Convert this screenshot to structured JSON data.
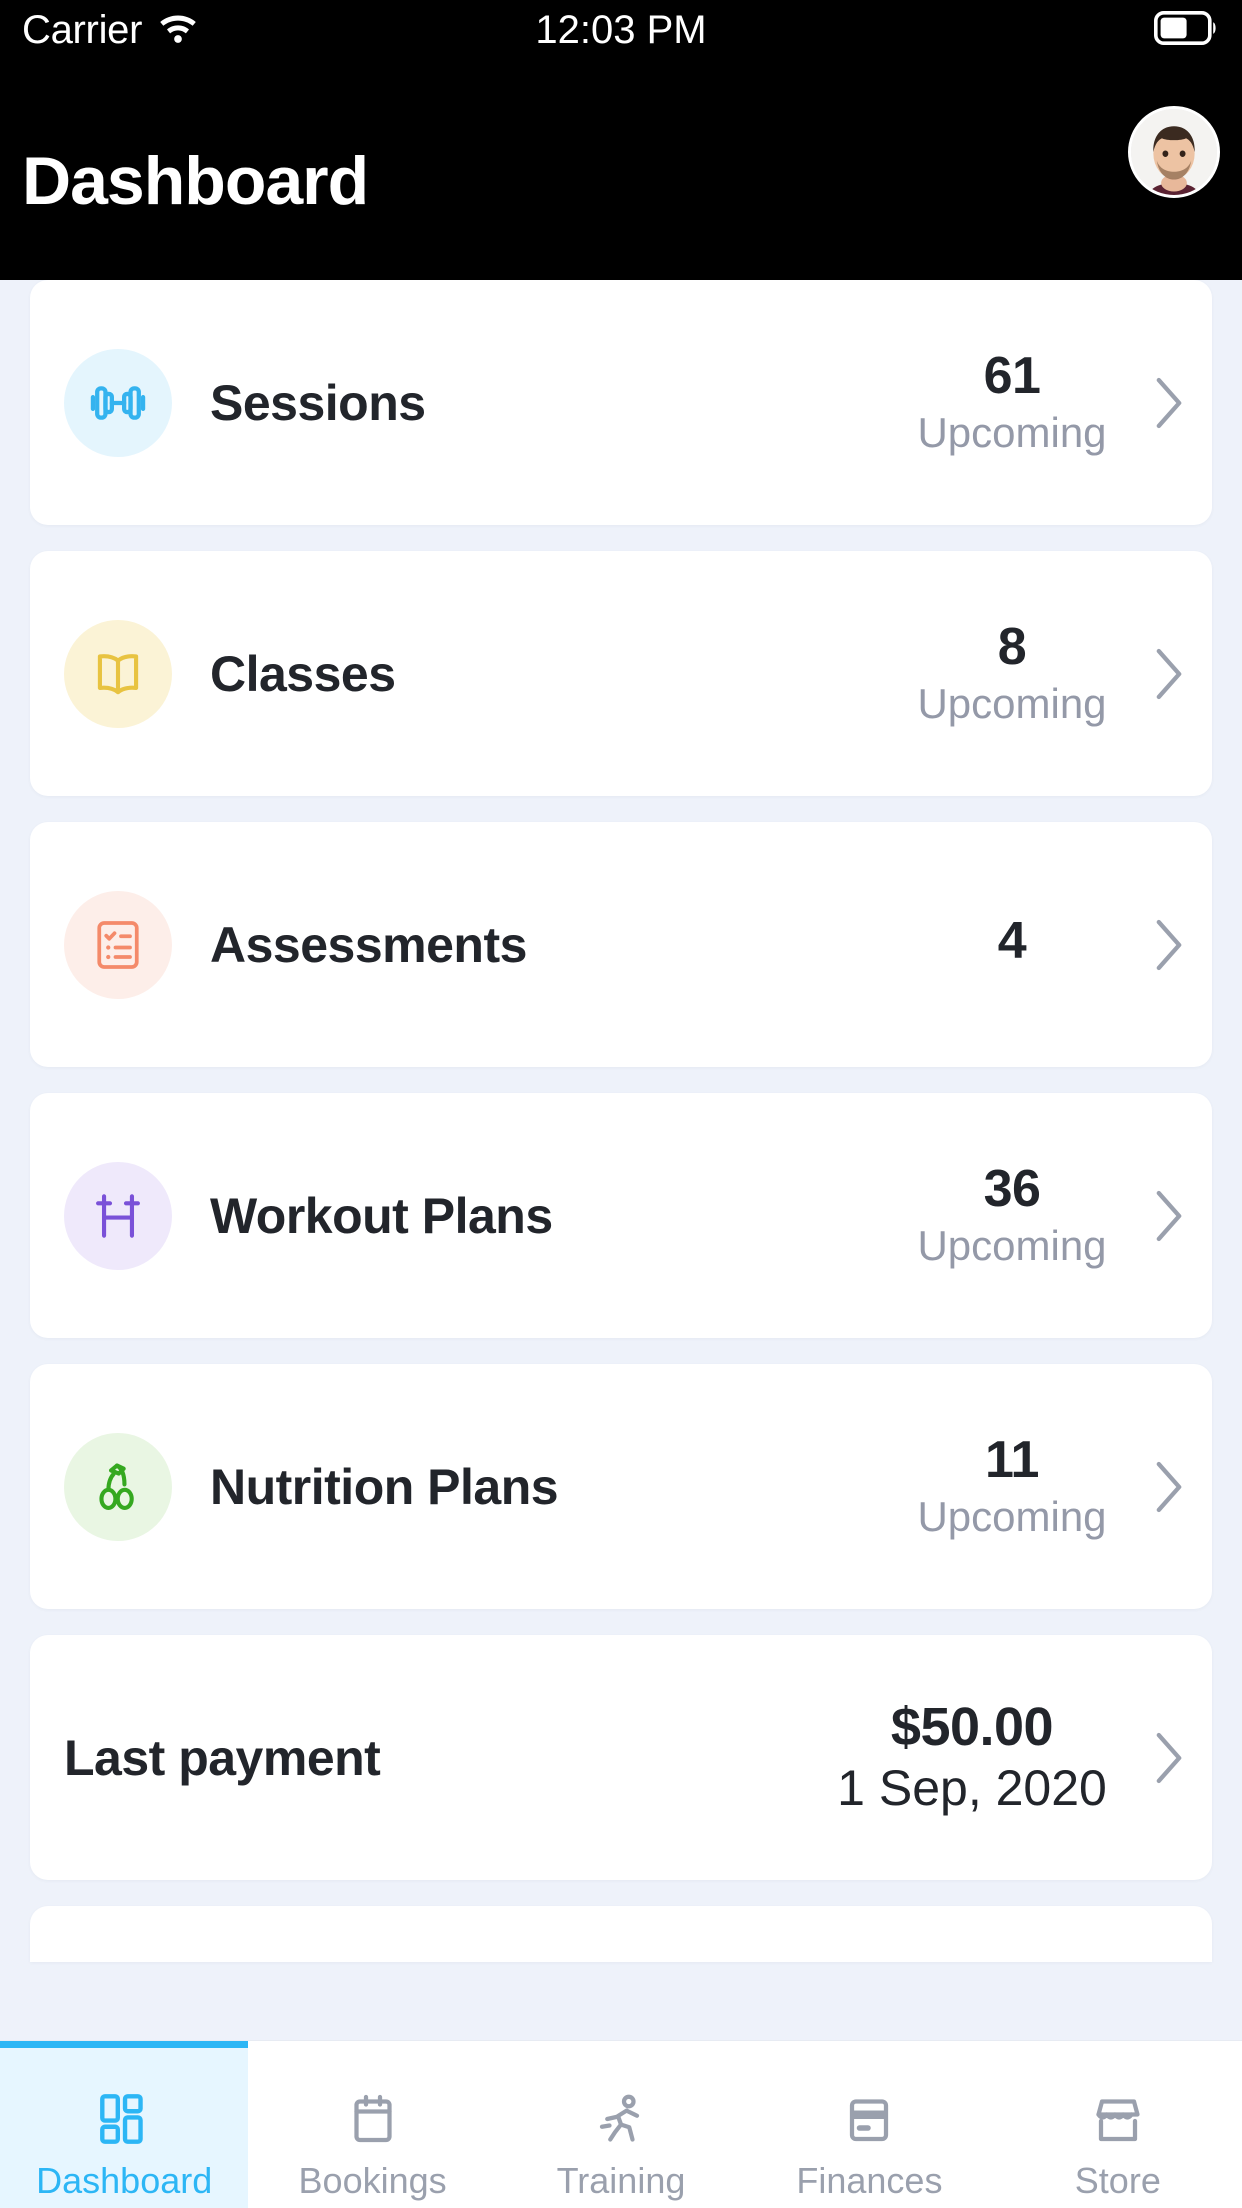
{
  "status_bar": {
    "carrier": "Carrier",
    "wifi_icon": "wifi-icon",
    "time": "12:03 PM",
    "battery_icon": "battery-icon"
  },
  "header": {
    "title": "Dashboard",
    "avatar_icon": "avatar"
  },
  "colors": {
    "accent": "#2cb6f5",
    "page_background": "#eef2fa",
    "card_background": "#ffffff",
    "header_background": "#000000",
    "value_text": "#22252b",
    "muted_text": "#9499a8"
  },
  "cards": [
    {
      "label": "Sessions",
      "value": "61",
      "sub": "Upcoming",
      "icon": "dumbbell-icon",
      "icon_color": "#34b3ef",
      "icon_bg": "#e4f5fd"
    },
    {
      "label": "Classes",
      "value": "8",
      "sub": "Upcoming",
      "icon": "open-book-icon",
      "icon_color": "#e8c341",
      "icon_bg": "#fbf3d6"
    },
    {
      "label": "Assessments",
      "value": "4",
      "sub": "",
      "icon": "clipboard-checklist-icon",
      "icon_color": "#f48a6a",
      "icon_bg": "#fdeee9"
    },
    {
      "label": "Workout Plans",
      "value": "36",
      "sub": "Upcoming",
      "icon": "barbell-icon",
      "icon_color": "#7a51d8",
      "icon_bg": "#efe9fb"
    },
    {
      "label": "Nutrition Plans",
      "value": "11",
      "sub": "Upcoming",
      "icon": "cherries-icon",
      "icon_color": "#35a820",
      "icon_bg": "#e9f6e3"
    }
  ],
  "payment_card": {
    "label": "Last payment",
    "amount": "$50.00",
    "date": "1 Sep, 2020"
  },
  "tabs": [
    {
      "label": "Dashboard",
      "icon": "dashboard-grid-icon",
      "active": true
    },
    {
      "label": "Bookings",
      "icon": "calendar-icon",
      "active": false
    },
    {
      "label": "Training",
      "icon": "running-person-icon",
      "active": false
    },
    {
      "label": "Finances",
      "icon": "credit-card-icon",
      "active": false
    },
    {
      "label": "Store",
      "icon": "storefront-icon",
      "active": false
    }
  ],
  "chevron_icon": "chevron-right-icon"
}
